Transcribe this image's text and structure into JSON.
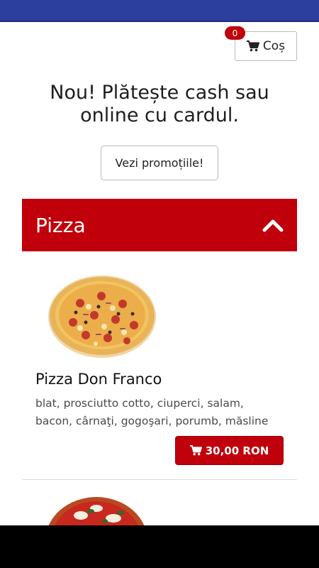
{
  "cart": {
    "label": "Coș",
    "count": "0"
  },
  "promo": {
    "title": "Nou! Plătește cash sau online cu cardul.",
    "button_label": "Vezi promoțiile!"
  },
  "category": {
    "name": "Pizza"
  },
  "products": [
    {
      "name": "Pizza Don Franco",
      "description": "blat, prosciutto cotto, ciuperci, salam, bacon, cârnaţi, gogoşari, porumb, măsline",
      "price": "30,00 RON"
    }
  ],
  "colors": {
    "status_bar": "#2c3e9e",
    "accent": "#c0000b"
  },
  "icons": {
    "cart": "cart-icon",
    "collapse": "chevron-up-icon"
  }
}
